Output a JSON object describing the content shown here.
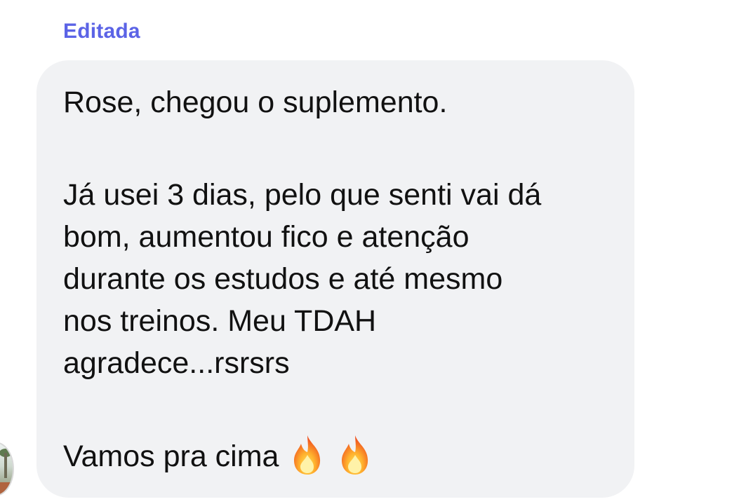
{
  "header": {
    "edited_label": "Editada"
  },
  "message": {
    "lines": [
      "Rose, chegou o suplemento.",
      "Já usei 3 dias, pelo que senti vai dá",
      "bom, aumentou fico e atenção",
      "durante os estudos e até mesmo",
      "nos treinos. Meu TDAH",
      "agradece...rsrsrs",
      "Vamos pra cima"
    ],
    "trailing_icons": [
      "fire-icon",
      "fire-icon"
    ]
  },
  "colors": {
    "edited_label": "#5b63e6",
    "bubble_background": "#f1f2f4",
    "text": "#111111"
  }
}
